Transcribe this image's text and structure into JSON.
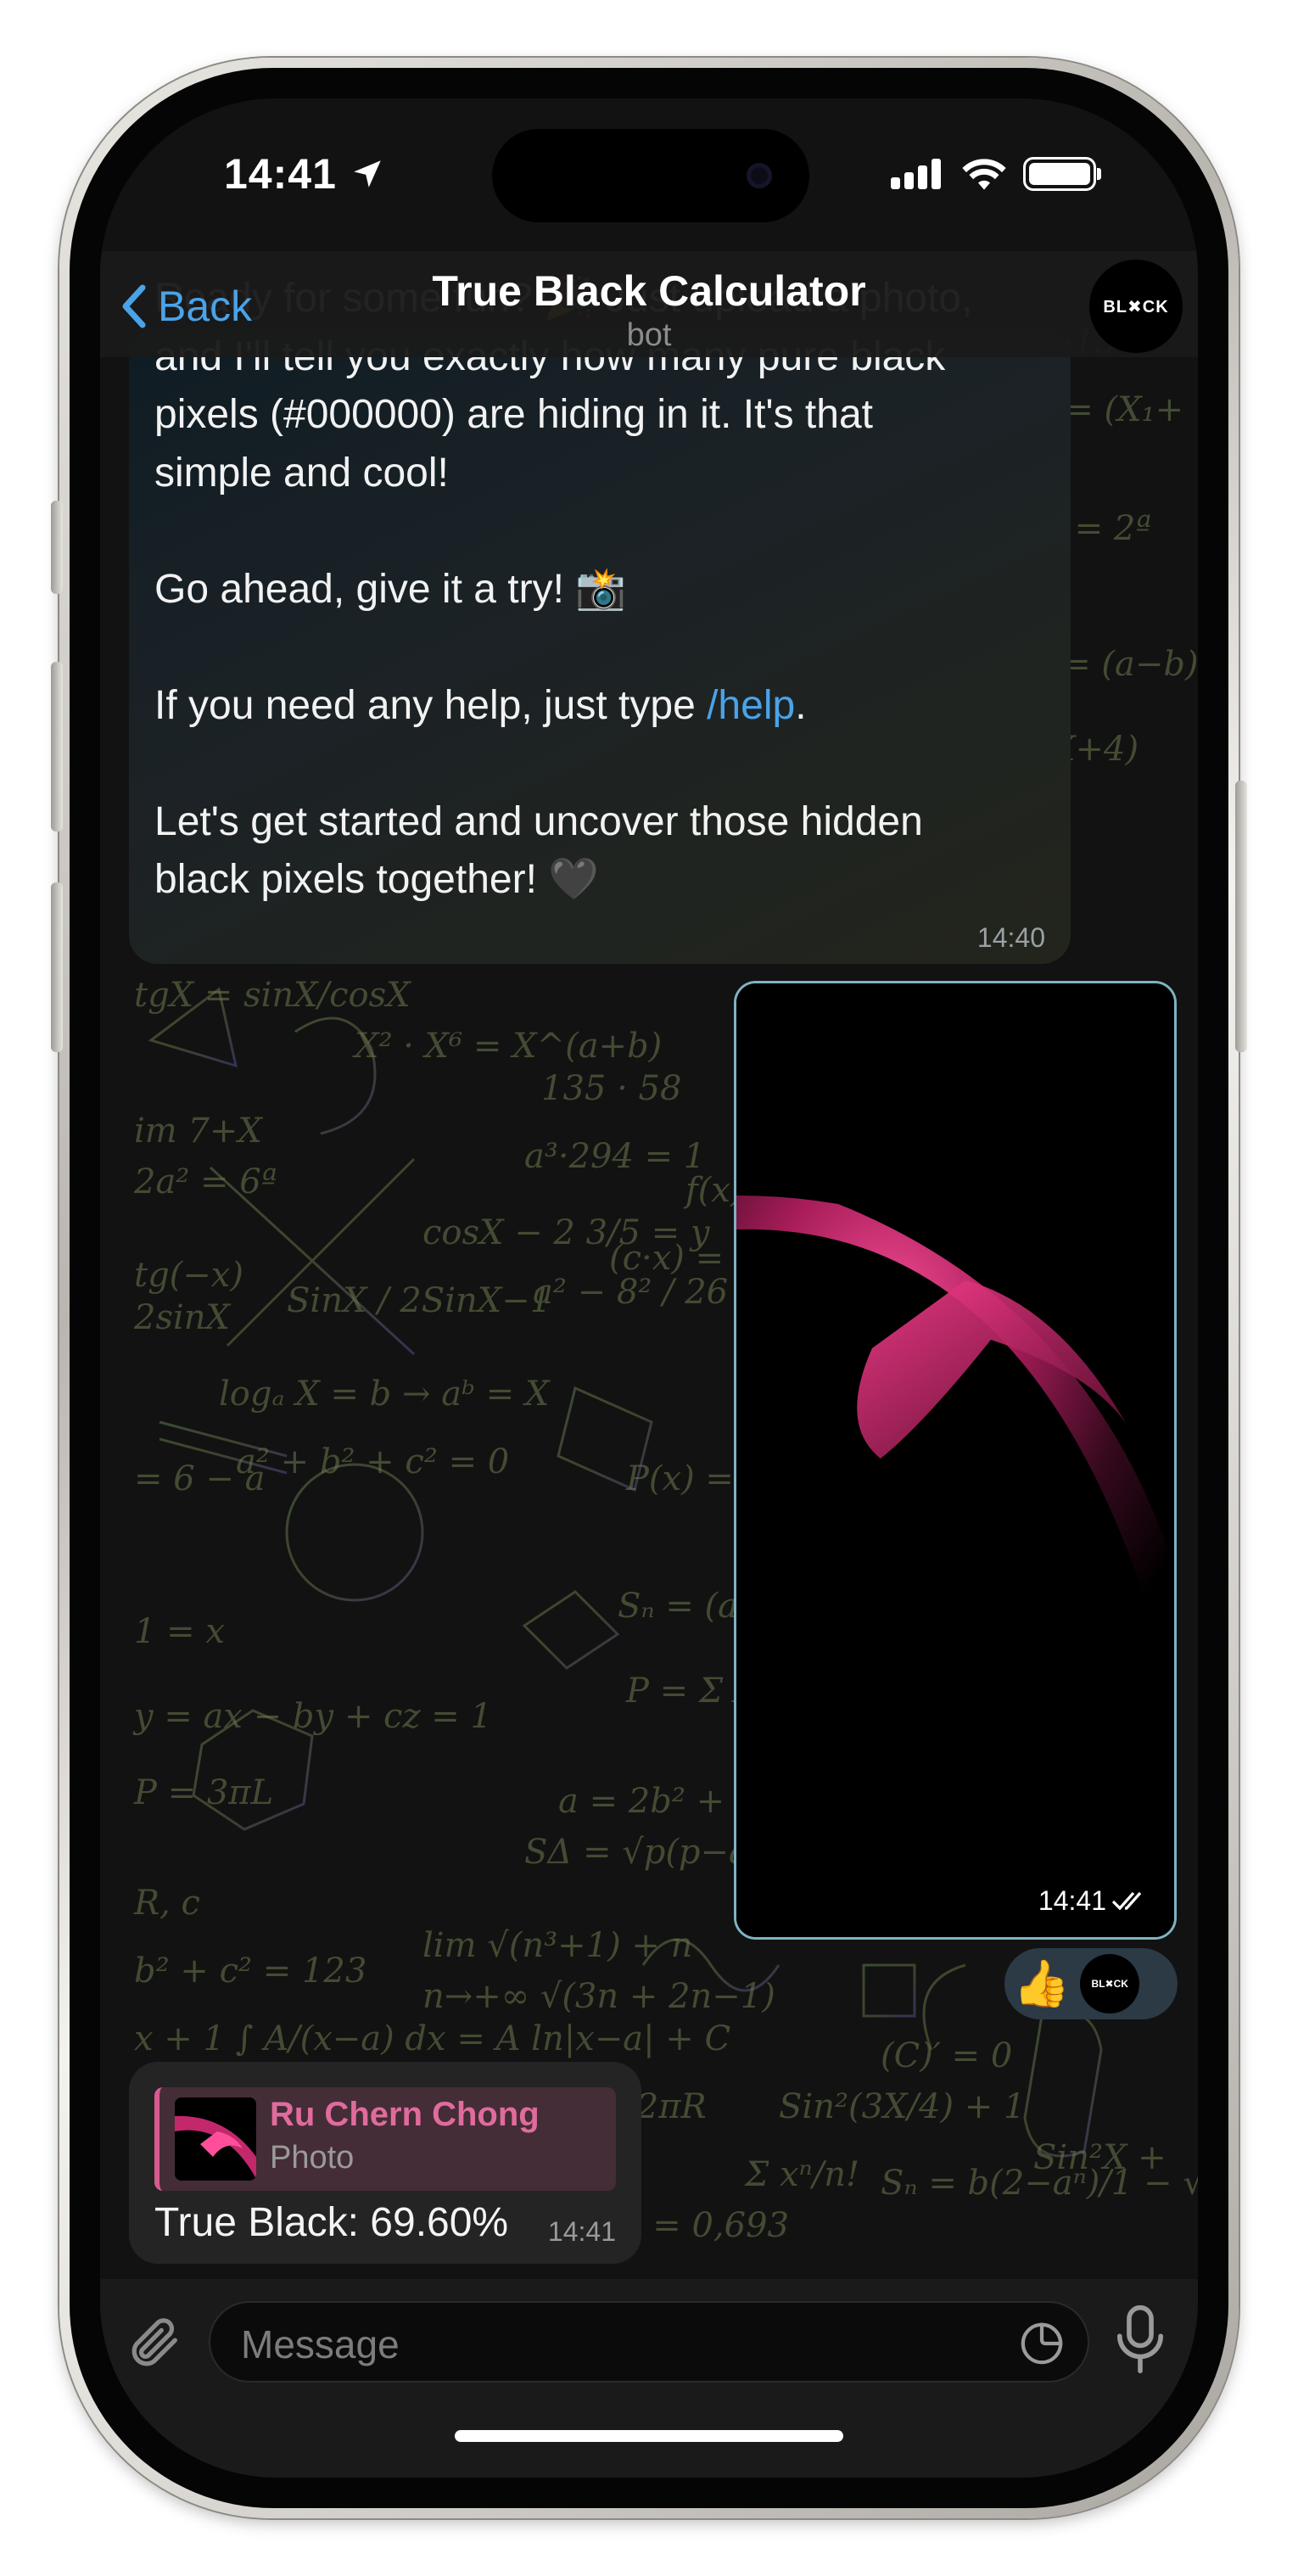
{
  "status": {
    "time": "14:41"
  },
  "navbar": {
    "back_label": "Back",
    "title": "True Black Calculator",
    "subtitle": "bot",
    "avatar_text": "BL✖CK"
  },
  "messages": {
    "bot_intro": {
      "lines_text": "Ready for some fun? 🎉 Just upload a photo,\nand I'll tell you exactly how many pure black\npixels (#000000) are hiding in it. It's that\nsimple and cool!\n\nGo ahead, give it a try! 📸\n\n",
      "help_prefix": "If you need any help, just type ",
      "help_link": "/help",
      "help_suffix": ".",
      "closing": "Let's get started and uncover those hidden\nblack pixels together! 🖤",
      "time": "14:40"
    },
    "photo": {
      "time": "14:41"
    },
    "reactions": {
      "emoji": "👍",
      "avatar_text": "BL✖CK"
    },
    "reply": {
      "sender": "Ru Chern Chong",
      "kind": "Photo",
      "text": "True Black: 69.60%",
      "time": "14:41"
    }
  },
  "composer": {
    "placeholder": "Message"
  },
  "colors": {
    "accent": "#4aa3e8",
    "sender_pink": "#e06b9d",
    "photo_border": "#7fb3c3"
  }
}
